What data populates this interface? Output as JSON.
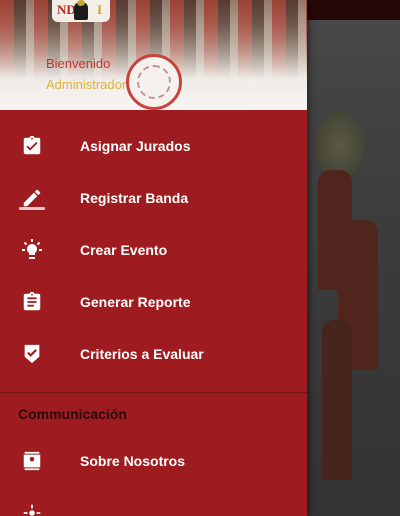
{
  "header": {
    "welcome_text": "Bienvenido",
    "role_text": "Administrador",
    "logo_letters": [
      "ND",
      "I"
    ]
  },
  "menu": [
    {
      "label": "Asignar Jurados",
      "icon": "assignment-check-icon"
    },
    {
      "label": "Registrar Banda",
      "icon": "edit-pencil-icon"
    },
    {
      "label": "Crear Evento",
      "icon": "event-bulb-icon"
    },
    {
      "label": "Generar Reporte",
      "icon": "report-clipboard-icon"
    },
    {
      "label": "Criterios a Evaluar",
      "icon": "checklist-shield-icon"
    }
  ],
  "communication": {
    "title": "Communicación",
    "items": [
      {
        "label": "Sobre Nosotros",
        "icon": "contact-card-icon"
      }
    ]
  },
  "colors": {
    "drawer": "#9e1b1f",
    "accent_gold": "#d9b43a",
    "welcome_red": "#c0352e"
  }
}
